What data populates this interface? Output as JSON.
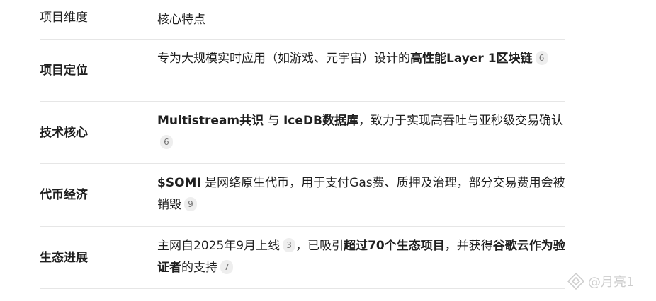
{
  "table": {
    "header": {
      "dimension": "项目维度",
      "feature": "核心特点"
    },
    "rows": [
      {
        "dimension": "项目定位",
        "parts": [
          {
            "text": "专为大规模实时应用（如游戏、元宇宙）设计的",
            "bold": false
          },
          {
            "text": "高性能Layer 1区块链",
            "bold": true
          }
        ],
        "cite": "6"
      },
      {
        "dimension": "技术核心",
        "parts": [
          {
            "text": "Multistream共识",
            "bold": true
          },
          {
            "text": " 与 ",
            "bold": false
          },
          {
            "text": "IceDB数据库",
            "bold": true
          },
          {
            "text": "，致力于实现高吞吐与亚秒级交易确认",
            "bold": false
          }
        ],
        "cite": "6"
      },
      {
        "dimension": "代币经济",
        "parts": [
          {
            "text": "$SOMI",
            "bold": true
          },
          {
            "text": " 是网络原生代币，用于支付Gas费、质押及治理，部分交易费用会被销毁",
            "bold": false
          }
        ],
        "cite": "9"
      },
      {
        "dimension": "生态进展",
        "parts": [
          {
            "text": "主网自2025年9月上线",
            "bold": false
          },
          {
            "cite": "3"
          },
          {
            "text": "，已吸引",
            "bold": false
          },
          {
            "text": "超过70个生态项目",
            "bold": true
          },
          {
            "text": "，并获得",
            "bold": false
          },
          {
            "text": "谷歌云作为验证者",
            "bold": true
          },
          {
            "text": "的支持",
            "bold": false
          }
        ],
        "cite": "7"
      }
    ]
  },
  "watermark": {
    "text": "@月亮1",
    "icon": "diamond-logo-icon"
  }
}
